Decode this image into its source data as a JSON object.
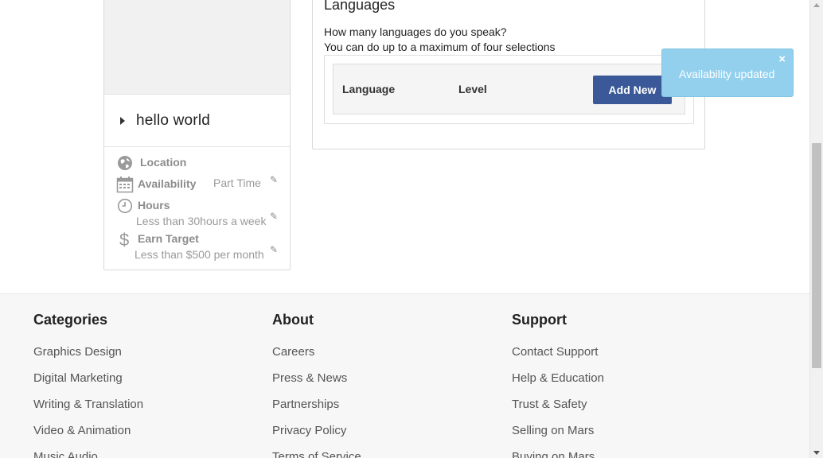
{
  "profile": {
    "name": "hello world",
    "details": {
      "location_label": "Location",
      "availability_label": "Availability",
      "availability_value": "Part Time",
      "hours_label": "Hours",
      "hours_value": "Less than 30hours a week",
      "earn_label": "Earn Target",
      "earn_value": "Less than $500 per month"
    }
  },
  "languages": {
    "title": "Languages",
    "question": "How many languages do you speak?",
    "hint": "You can do up to a maximum of four selections",
    "col_language": "Language",
    "col_level": "Level",
    "add_new_label": "Add New"
  },
  "toast": {
    "message": "Availability updated",
    "close_glyph": "×"
  },
  "footer": {
    "categories": {
      "heading": "Categories",
      "links": [
        "Graphics Design",
        "Digital Marketing",
        "Writing & Translation",
        "Video & Animation",
        "Music Audio"
      ]
    },
    "about": {
      "heading": "About",
      "links": [
        "Careers",
        "Press & News",
        "Partnerships",
        "Privacy Policy",
        "Terms of Service"
      ]
    },
    "support": {
      "heading": "Support",
      "links": [
        "Contact Support",
        "Help & Education",
        "Trust & Safety",
        "Selling on Mars",
        "Buying on Mars"
      ]
    }
  },
  "icons": {
    "globe": "globe-icon",
    "calendar": "calendar-icon",
    "clock": "clock-icon",
    "dollar": "dollar-icon",
    "pencil": "pencil-icon"
  },
  "colors": {
    "primary_button": "#3b5998",
    "toast_bg": "#92d0ee"
  }
}
